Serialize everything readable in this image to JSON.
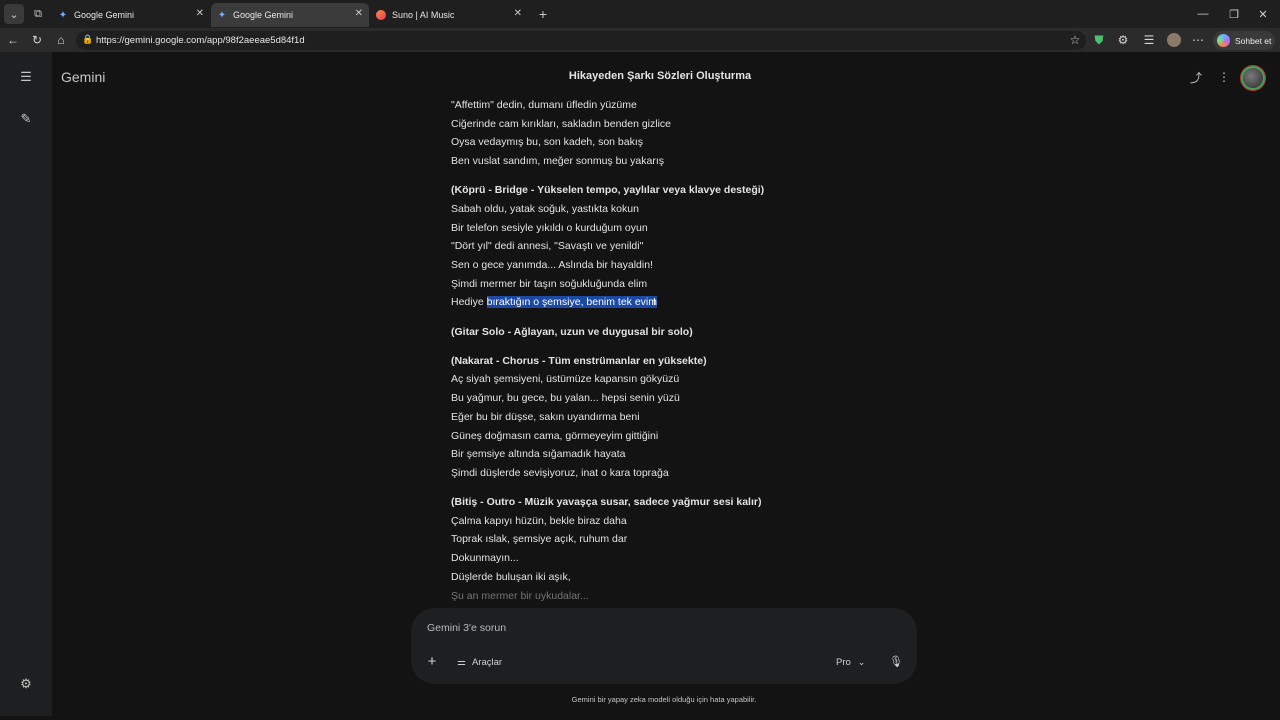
{
  "browser": {
    "tabs": [
      {
        "label": "Google Gemini",
        "icon": "gemini-icon",
        "active": false
      },
      {
        "label": "Google Gemini",
        "icon": "gemini-icon",
        "active": true
      },
      {
        "label": "Suno | AI Music",
        "icon": "suno-icon",
        "active": false
      }
    ],
    "url": "https://gemini.google.com/app/98f2aeeae5d84f1d",
    "copilot_label": "Sohbet et"
  },
  "app": {
    "brand": "Gemini",
    "chat_title": "Hikayeden Şarkı Sözleri Oluşturma"
  },
  "lyrics": {
    "verse_end": [
      "\"Affettim\" dedin, dumanı üfledin yüzüme",
      "Ciğerinde cam kırıkları, sakladın benden gizlice",
      "Oysa vedaymış bu, son kadeh, son bakış",
      "Ben vuslat sandım, meğer sonmuş bu yakarış"
    ],
    "bridge_header": "(Köprü - Bridge - Yükselen tempo, yaylılar veya klavye desteği)",
    "bridge": [
      "Sabah oldu, yatak soğuk, yastıkta kokun",
      "Bir telefon sesiyle yıkıldı o kurduğum oyun",
      "\"Dört yıl\" dedi annesi, \"Savaştı ve yenildi\"",
      "Sen o gece yanımda... Aslında bir hayaldin!",
      "Şimdi mermer bir taşın soğukluğunda elim"
    ],
    "bridge_last_prefix": "Hediye ",
    "bridge_last_selected": "bıraktığın o şemsiye, benim tek evim",
    "solo_header": "(Gitar Solo - Ağlayan, uzun ve duygusal bir solo)",
    "chorus_header": "(Nakarat - Chorus - Tüm enstrümanlar en yüksekte)",
    "chorus": [
      "Aç siyah şemsiyeni, üstümüze kapansın gökyüzü",
      "Bu yağmur, bu gece, bu yalan... hepsi senin yüzü",
      "Eğer bu bir düşse, sakın uyandırma beni",
      "Güneş doğmasın cama, görmeyeyim gittiğini",
      "Bir şemsiye altında sığamadık hayata",
      "Şimdi düşlerde sevişiyoruz, inat o kara toprağa"
    ],
    "outro_header": "(Bitiş - Outro - Müzik yavaşça susar, sadece yağmur sesi kalır)",
    "outro": [
      "Çalma kapıyı hüzün, bekle biraz daha",
      "Toprak ıslak, şemsiye açık, ruhum dar",
      "Dokunmayın...",
      "Düşlerde buluşan iki aşık,"
    ],
    "outro_faded": "Şu an mermer bir uykudalar..."
  },
  "composer": {
    "placeholder": "Gemini 3'e sorun",
    "tools_label": "Araçlar",
    "model_label": "Pro"
  },
  "footer": {
    "disclaimer": "Gemini bir yapay zeka modeli olduğu için hata yapabilir."
  }
}
